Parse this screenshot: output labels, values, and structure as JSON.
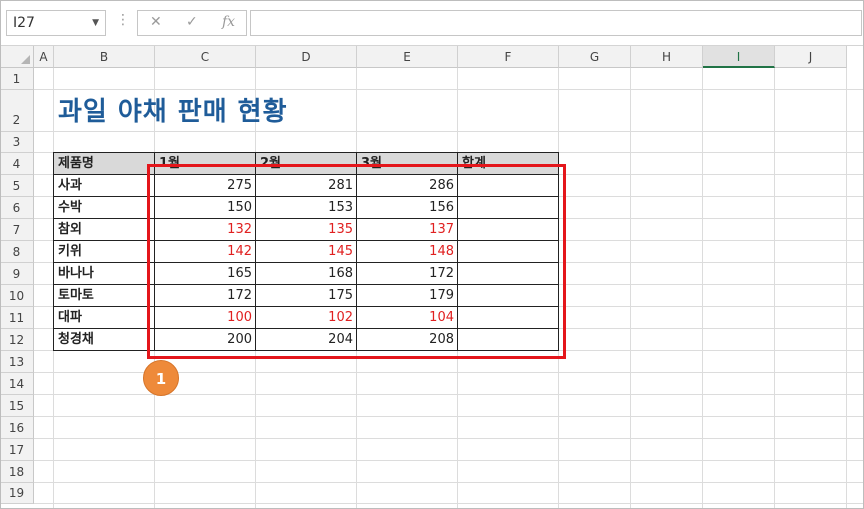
{
  "formula_bar": {
    "name_box": "I27",
    "cancel_symbol": "✕",
    "enter_symbol": "✓",
    "fx_symbol": "fx",
    "formula_value": ""
  },
  "columns": [
    "A",
    "B",
    "C",
    "D",
    "E",
    "F",
    "G",
    "H",
    "I",
    "J"
  ],
  "selected_column": "I",
  "rows": [
    "1",
    "2",
    "3",
    "4",
    "5",
    "6",
    "7",
    "8",
    "9",
    "10",
    "11",
    "12",
    "13",
    "14",
    "15",
    "16",
    "17",
    "18",
    "19"
  ],
  "sheet": {
    "title": "과일 야채 판매 현황",
    "headers": [
      "제품명",
      "1월",
      "2월",
      "3월",
      "합계"
    ],
    "products": [
      {
        "name": "사과",
        "values": [
          "275",
          "281",
          "286"
        ],
        "red": false
      },
      {
        "name": "수박",
        "values": [
          "150",
          "153",
          "156"
        ],
        "red": false
      },
      {
        "name": "참외",
        "values": [
          "132",
          "135",
          "137"
        ],
        "red": true
      },
      {
        "name": "키위",
        "values": [
          "142",
          "145",
          "148"
        ],
        "red": true
      },
      {
        "name": "바나나",
        "values": [
          "165",
          "168",
          "172"
        ],
        "red": false
      },
      {
        "name": "토마토",
        "values": [
          "172",
          "175",
          "179"
        ],
        "red": false
      },
      {
        "name": "대파",
        "values": [
          "100",
          "102",
          "104"
        ],
        "red": true
      },
      {
        "name": "청경채",
        "values": [
          "200",
          "204",
          "208"
        ],
        "red": false
      }
    ],
    "value_color_red": "#e02020"
  },
  "annotation": {
    "badge": "1",
    "highlight_color": "#e4161b",
    "badge_color": "#ee8a3a"
  }
}
